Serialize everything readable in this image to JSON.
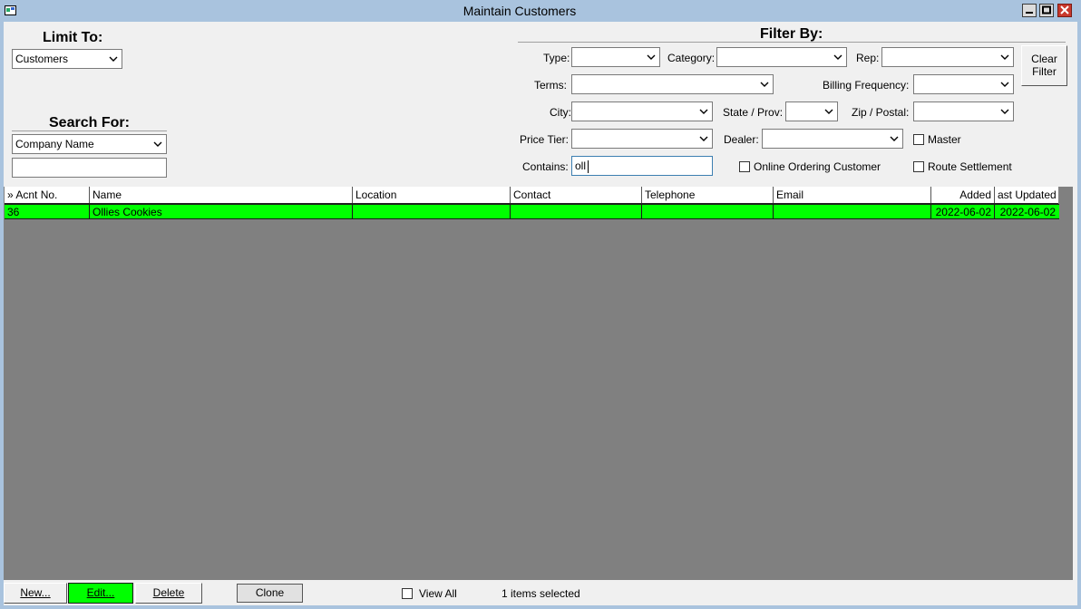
{
  "window": {
    "title": "Maintain Customers"
  },
  "limit_to": {
    "heading": "Limit To:",
    "value": "Customers"
  },
  "search_for": {
    "heading": "Search For:",
    "field": "Company Name",
    "text": ""
  },
  "filter_by": {
    "heading": "Filter By:",
    "type_label": "Type:",
    "category_label": "Category:",
    "rep_label": "Rep:",
    "terms_label": "Terms:",
    "billing_frequency_label": "Billing Frequency:",
    "city_label": "City:",
    "state_label": "State / Prov:",
    "zip_label": "Zip / Postal:",
    "price_tier_label": "Price Tier:",
    "dealer_label": "Dealer:",
    "master_label": "Master",
    "contains_label": "Contains:",
    "contains_value": "oll",
    "online_label": "Online Ordering Customer",
    "route_label": "Route Settlement",
    "clear_line1": "Clear",
    "clear_line2": "Filter"
  },
  "grid": {
    "columns": [
      "» Acnt No.",
      "Name",
      "Location",
      "Contact",
      "Telephone",
      "Email",
      "Added",
      "ast Updated"
    ],
    "rows": [
      {
        "acnt": "36",
        "name": "Ollies Cookies",
        "location": "",
        "contact": "",
        "telephone": "",
        "email": "",
        "added": "2022-06-02",
        "updated": "2022-06-02"
      }
    ]
  },
  "footer": {
    "new_label": "New...",
    "edit_label": "Edit...",
    "delete_label": "Delete",
    "clone_label": "Clone",
    "view_all_label": "View All",
    "status": "1 items selected"
  },
  "colors": {
    "highlight": "#00ff00",
    "grid_bg": "#808080",
    "titlebar": "#a9c3de"
  }
}
